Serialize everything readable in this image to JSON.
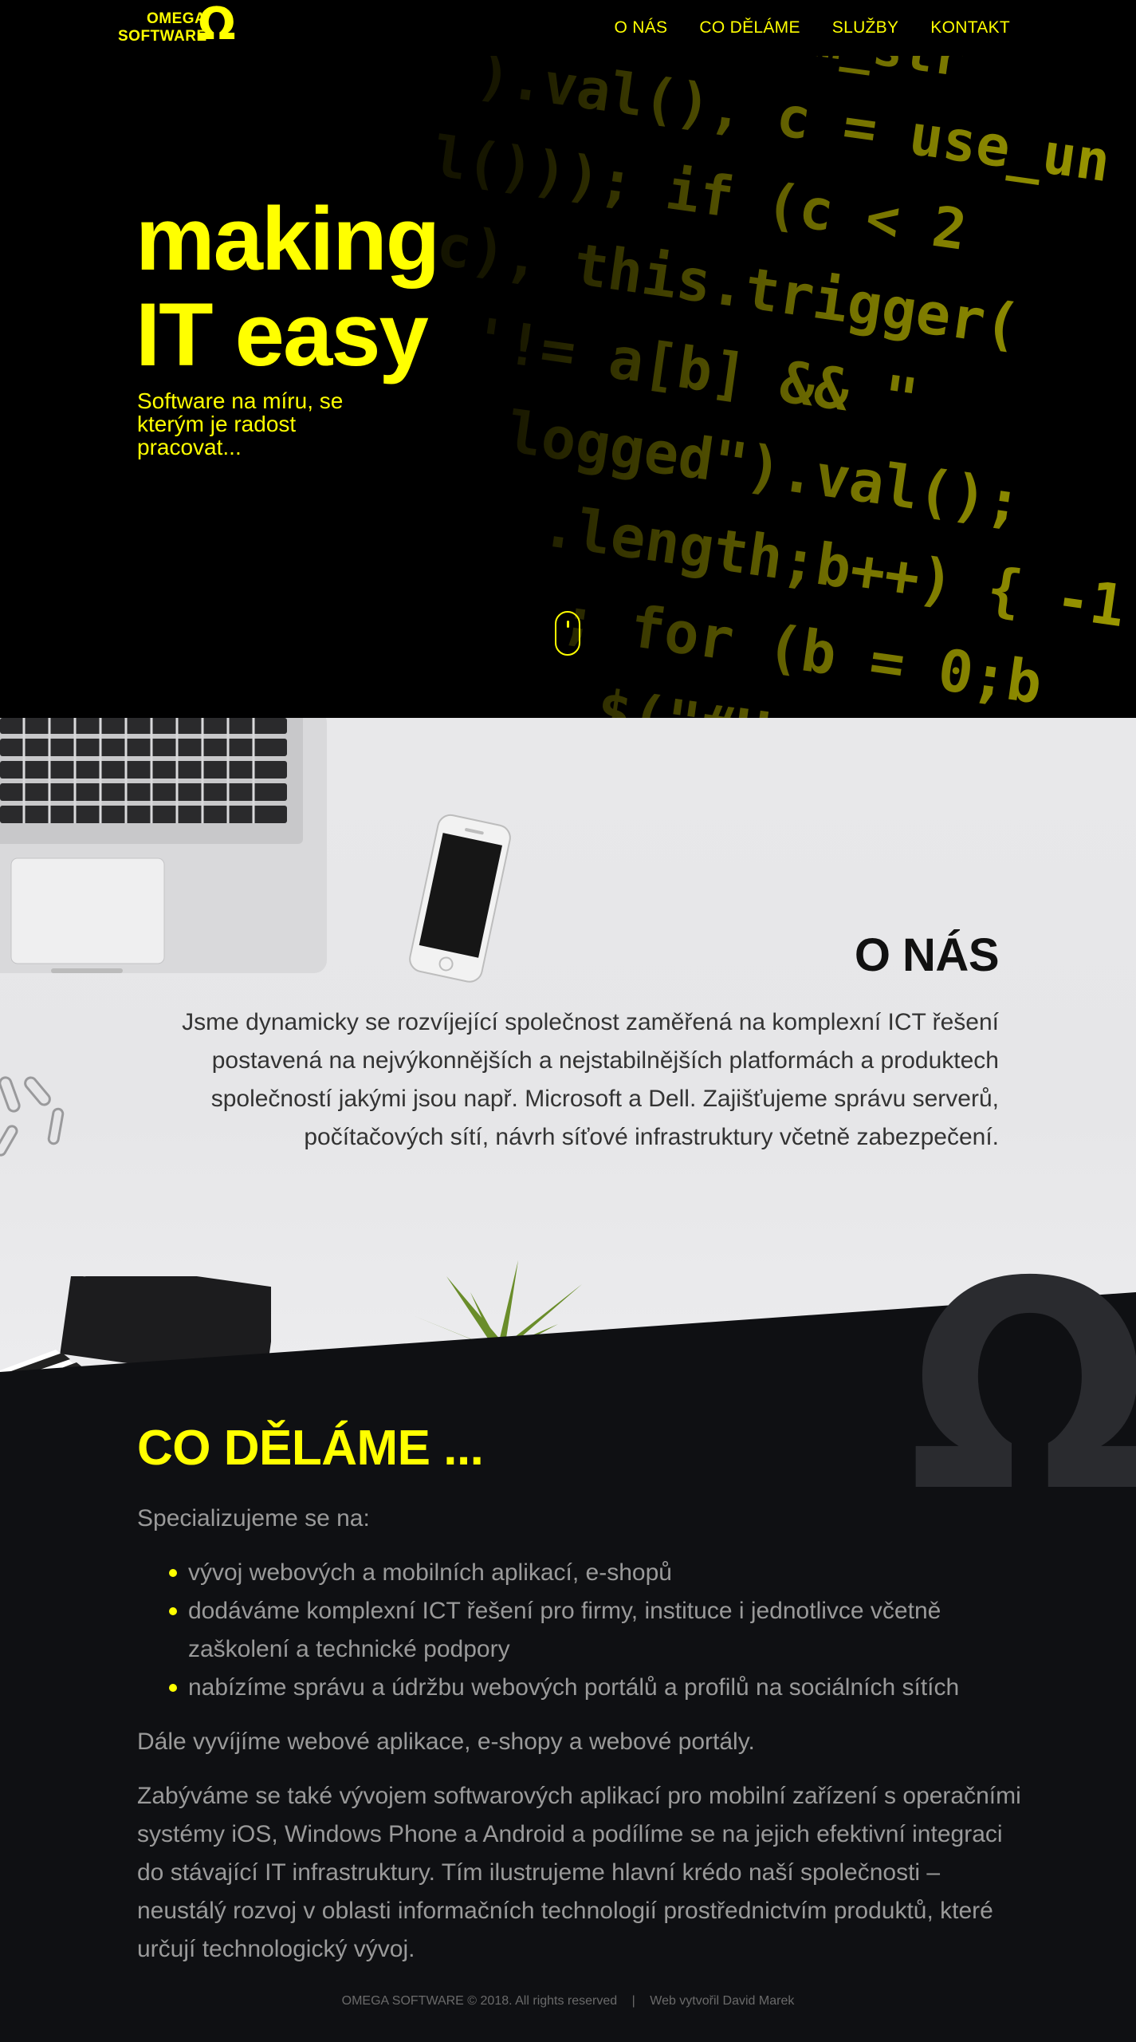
{
  "nav": {
    "logo_line1": "OMEGA",
    "logo_line2": "SOFTWARE",
    "logo_symbol": "Ω",
    "items": [
      {
        "label": "O NÁS"
      },
      {
        "label": "CO DĚLÁME"
      },
      {
        "label": "SLUŽBY"
      },
      {
        "label": "KONTAKT"
      }
    ]
  },
  "hero": {
    "title_line1": "making",
    "title_line2": "IT easy",
    "subtitle": "Software na míru, se kterým je radost pracovat..."
  },
  "about": {
    "title": "O NÁS",
    "text": "Jsme dynamicky se rozvíjející společnost zaměřená na komplexní ICT řešení postavená na nejvýkonnějších a nejstabilnějších platformách a produktech společností jakými jsou např. Microsoft a Dell. Zajišťujeme správu serverů, počítačových sítí, návrh síťové infrastruktury včetně zabezpečení."
  },
  "services": {
    "title": "CO DĚLÁME ...",
    "intro": "Specializujeme se na:",
    "list": [
      "vývoj webových a mobilních aplikací, e-shopů",
      "dodáváme komplexní ICT řešení pro firmy, instituce i jednotlivce včetně zaškolení a technické podpory",
      "nabízíme správu a údržbu webových portálů a profilů na sociálních sítích"
    ],
    "p2": "Dále vyvíjíme webové aplikace, e-shopy a webové portály.",
    "p3": "Zabýváme se také vývojem softwarových aplikací pro mobilní zařízení s operačními systémy iOS, Windows Phone a Android a podílíme se na jejich efektivní integraci do stávající IT infrastruktury. Tím ilustrujeme hlavní krédo naší společnosti – neustálý rozvoj v oblasti informačních technologií prostřednictvím produktů, které určují technologický vývoj."
  },
  "footer": {
    "copyright": "OMEGA SOFTWARE © 2018. All rights reserved",
    "separator": "|",
    "credit": "Web vytvořil David Marek"
  },
  "colors": {
    "accent": "#ffff00",
    "dark": "#0f1013",
    "light": "#e8e8ea"
  }
}
